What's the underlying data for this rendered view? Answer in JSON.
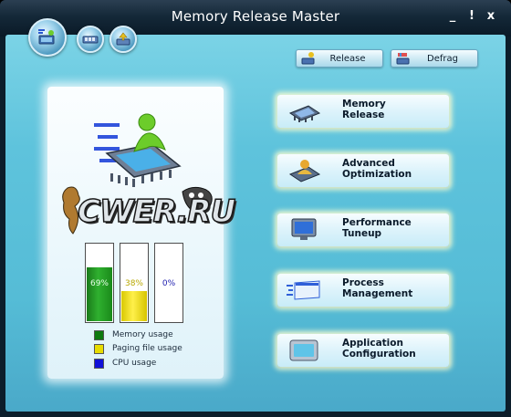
{
  "window": {
    "title": "Memory Release Master",
    "controls": {
      "minimize": "_",
      "help": "!",
      "close": "x"
    }
  },
  "nav": {
    "icons": [
      "chip-computer-icon",
      "memory-module-icon",
      "optimize-icon"
    ]
  },
  "toolbar": {
    "release_label": "Release",
    "defrag_label": "Defrag"
  },
  "status": {
    "watermark": "CWER.RU",
    "gauges": [
      {
        "name": "memory",
        "value_label": "69%",
        "value": 0.69,
        "color": "#1f9a1f"
      },
      {
        "name": "paging",
        "value_label": "38%",
        "value": 0.38,
        "color": "#f0e020"
      },
      {
        "name": "cpu",
        "value_label": "0%",
        "value": 0.0,
        "color": "#1010d0"
      }
    ],
    "legend": [
      {
        "label": "Memory usage",
        "color": "#0f7a0f"
      },
      {
        "label": "Paging file usage",
        "color": "#e8dc00"
      },
      {
        "label": "CPU usage",
        "color": "#1010d8"
      }
    ]
  },
  "actions": [
    {
      "label": "Memory\nRelease",
      "icon": "memory-chip-icon"
    },
    {
      "label": "Advanced\nOptimization",
      "icon": "user-chip-icon"
    },
    {
      "label": "Performance\nTuneup",
      "icon": "monitor-icon"
    },
    {
      "label": "Process\nManagement",
      "icon": "process-window-icon"
    },
    {
      "label": "Application\nConfiguration",
      "icon": "config-screen-icon"
    }
  ]
}
